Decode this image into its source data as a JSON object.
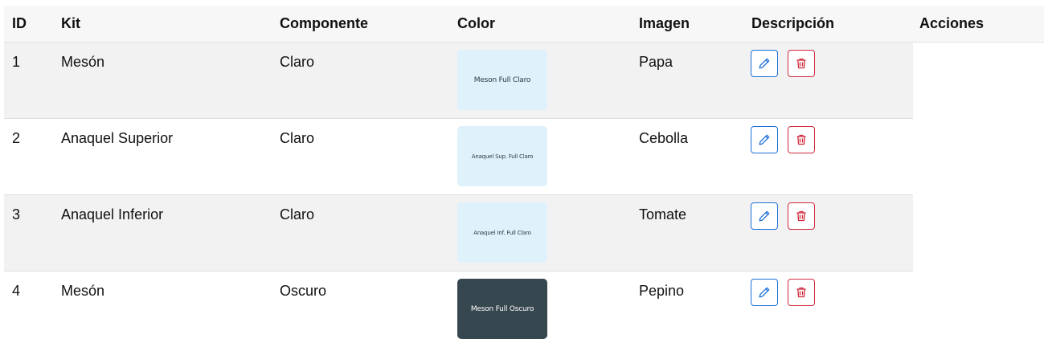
{
  "table": {
    "headers": {
      "id": "ID",
      "kit": "Kit",
      "componente": "Componente",
      "color": "Color",
      "imagen": "Imagen",
      "descripcion": "Descripción",
      "acciones": "Acciones"
    },
    "rows": [
      {
        "id": "1",
        "kit": "Mesón",
        "componente": "Claro",
        "color_label": "Meson Full Claro",
        "imagen": "Papa"
      },
      {
        "id": "2",
        "kit": "Anaquel Superior",
        "componente": "Claro",
        "color_label": "Anaquel Sup. Full Claro",
        "imagen": "Cebolla"
      },
      {
        "id": "3",
        "kit": "Anaquel Inferior",
        "componente": "Claro",
        "color_label": "Anaquel Inf. Full Claro",
        "imagen": "Tomate"
      },
      {
        "id": "4",
        "kit": "Mesón",
        "componente": "Oscuro",
        "color_label": "Meson Full Oscuro",
        "imagen": "Pepino"
      }
    ]
  },
  "colors": {
    "swatch_light_bg": "#dff1fb",
    "swatch_light_text": "#2f3a45",
    "swatch_dark_bg": "#37474f",
    "swatch_dark_text": "#ffffff",
    "edit_accent": "#1b6ed6",
    "delete_accent": "#d0293d",
    "stripe": "#f2f2f2"
  },
  "icons": {
    "edit": "pencil-icon",
    "delete": "trash-icon"
  }
}
